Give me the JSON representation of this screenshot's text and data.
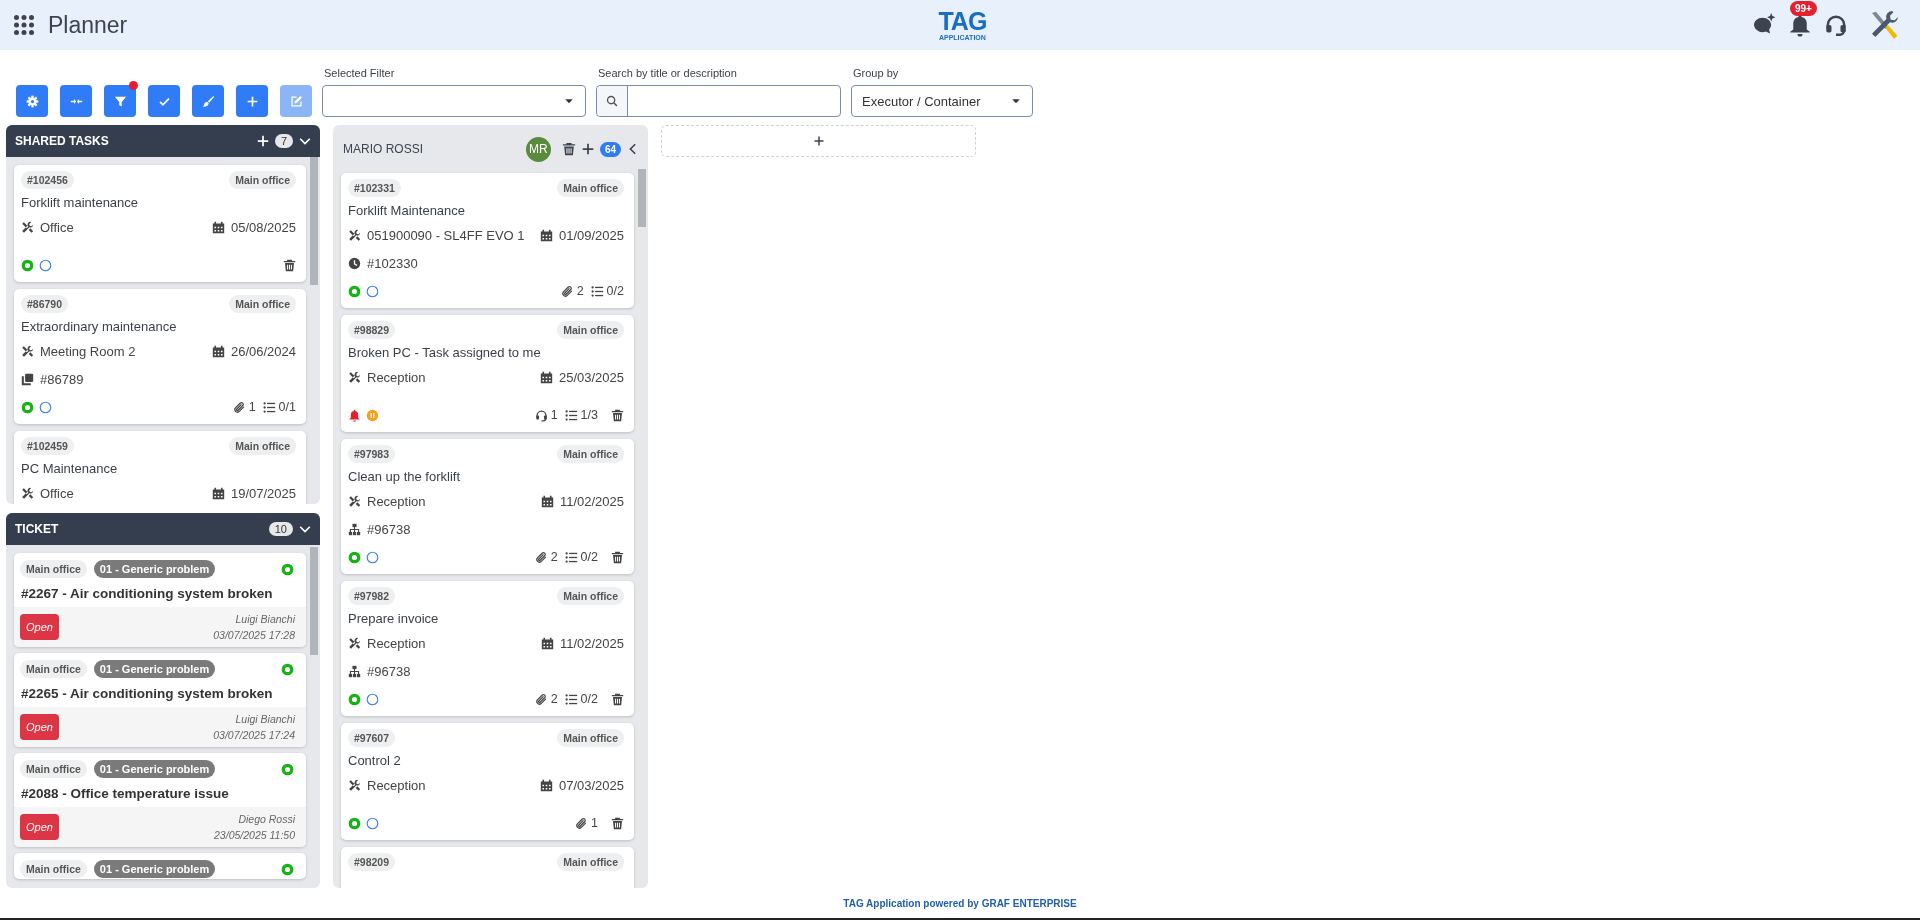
{
  "header": {
    "title": "Planner",
    "logo": {
      "name": "TAG",
      "tagline": "APPLICATION"
    },
    "notifications": "99+"
  },
  "toolbar": [
    {
      "kind": "settings",
      "disabled": false,
      "alert": false
    },
    {
      "kind": "collapse",
      "disabled": false,
      "alert": false
    },
    {
      "kind": "filter",
      "disabled": false,
      "alert": true
    },
    {
      "kind": "check",
      "disabled": false,
      "alert": false
    },
    {
      "kind": "brush",
      "disabled": false,
      "alert": false
    },
    {
      "kind": "add",
      "disabled": false,
      "alert": false
    },
    {
      "kind": "edit",
      "disabled": true,
      "alert": false
    }
  ],
  "fields": [
    {
      "kind": "select",
      "label": "Selected Filter"
    },
    {
      "kind": "search",
      "label": "Search by title or description"
    },
    {
      "kind": "select",
      "label": "Group by",
      "value": "Executor / Container"
    }
  ],
  "shared_tasks": {
    "title": "SHARED TASKS",
    "count": "7",
    "cards": [
      {
        "id": "#102456",
        "location": "Main office",
        "title": "Forklift maintenance",
        "asset": "Office",
        "date": "05/08/2025",
        "indicators": [
          {
            "kind": "ring"
          },
          {
            "kind": "circle"
          }
        ],
        "deletable": true
      },
      {
        "id": "#86790",
        "location": "Main office",
        "title": "Extraordinary maintenance",
        "asset": "Meeting Room 2",
        "date": "26/06/2024",
        "link": {
          "kind": "copy",
          "ref": "#86789"
        },
        "indicators": [
          {
            "kind": "ring"
          },
          {
            "kind": "circle"
          }
        ],
        "counters": [
          {
            "kind": "attachments",
            "value": "1"
          },
          {
            "kind": "checklist",
            "value": "0/1"
          }
        ],
        "deletable": false
      },
      {
        "id": "#102459",
        "location": "Main office",
        "title": "PC Maintenance",
        "asset": "Office",
        "date": "19/07/2025",
        "deletable": false
      }
    ]
  },
  "tickets": {
    "title": "TICKET",
    "count": "10",
    "cards": [
      {
        "location": "Main office",
        "category": "01 - Generic problem",
        "indicator": {
          "kind": "ring"
        },
        "title": "#2267 - Air conditioning system broken",
        "status": "Open",
        "author": "Luigi Bianchi",
        "datetime": "03/07/2025 17:28"
      },
      {
        "location": "Main office",
        "category": "01 - Generic problem",
        "indicator": {
          "kind": "ring"
        },
        "title": "#2265 - Air conditioning system broken",
        "status": "Open",
        "author": "Luigi Bianchi",
        "datetime": "03/07/2025 17:24"
      },
      {
        "location": "Main office",
        "category": "01 - Generic problem",
        "indicator": {
          "kind": "ring"
        },
        "title": "#2088 - Office temperature issue",
        "status": "Open",
        "author": "Diego Rossi",
        "datetime": "23/05/2025 11:50"
      },
      {
        "location": "Main office",
        "category": "01 - Generic problem",
        "indicator": {
          "kind": "ring"
        }
      }
    ]
  },
  "executor": {
    "name": "MARIO ROSSI",
    "initials": "MR",
    "count": "64",
    "cards": [
      {
        "id": "#102331",
        "location": "Main office",
        "title": "Forklift Maintenance",
        "asset": "051900090 - SL4FF EVO 1",
        "date": "01/09/2025",
        "link": {
          "kind": "clock",
          "ref": "#102330"
        },
        "indicators": [
          {
            "kind": "ring"
          },
          {
            "kind": "circle"
          }
        ],
        "counters": [
          {
            "kind": "attachments",
            "value": "2"
          },
          {
            "kind": "checklist",
            "value": "0/2"
          }
        ],
        "deletable": false
      },
      {
        "id": "#98829",
        "location": "Main office",
        "title": "Broken PC - Task assigned to me",
        "asset": "Reception",
        "date": "25/03/2025",
        "indicators": [
          {
            "kind": "bell"
          },
          {
            "kind": "pause"
          }
        ],
        "counters": [
          {
            "kind": "tickets",
            "value": "1"
          },
          {
            "kind": "checklist",
            "value": "1/3"
          }
        ],
        "deletable": true
      },
      {
        "id": "#97983",
        "location": "Main office",
        "title": "Clean up the forklift",
        "asset": "Reception",
        "date": "11/02/2025",
        "link": {
          "kind": "hierarchy",
          "ref": "#96738"
        },
        "indicators": [
          {
            "kind": "ring"
          },
          {
            "kind": "circle"
          }
        ],
        "counters": [
          {
            "kind": "attachments",
            "value": "2"
          },
          {
            "kind": "checklist",
            "value": "0/2"
          }
        ],
        "deletable": true
      },
      {
        "id": "#97982",
        "location": "Main office",
        "title": "Prepare invoice",
        "asset": "Reception",
        "date": "11/02/2025",
        "link": {
          "kind": "hierarchy",
          "ref": "#96738"
        },
        "indicators": [
          {
            "kind": "ring"
          },
          {
            "kind": "circle"
          }
        ],
        "counters": [
          {
            "kind": "attachments",
            "value": "2"
          },
          {
            "kind": "checklist",
            "value": "0/2"
          }
        ],
        "deletable": true
      },
      {
        "id": "#97607",
        "location": "Main office",
        "title": "Control 2",
        "asset": "Reception",
        "date": "07/03/2025",
        "indicators": [
          {
            "kind": "ring"
          },
          {
            "kind": "circle"
          }
        ],
        "counters": [
          {
            "kind": "attachments",
            "value": "1"
          }
        ],
        "deletable": true
      },
      {
        "id": "#98209",
        "location": "Main office",
        "deletable": false
      }
    ]
  },
  "footer": {
    "text": "TAG Application powered by GRAF ENTERPRISE"
  }
}
